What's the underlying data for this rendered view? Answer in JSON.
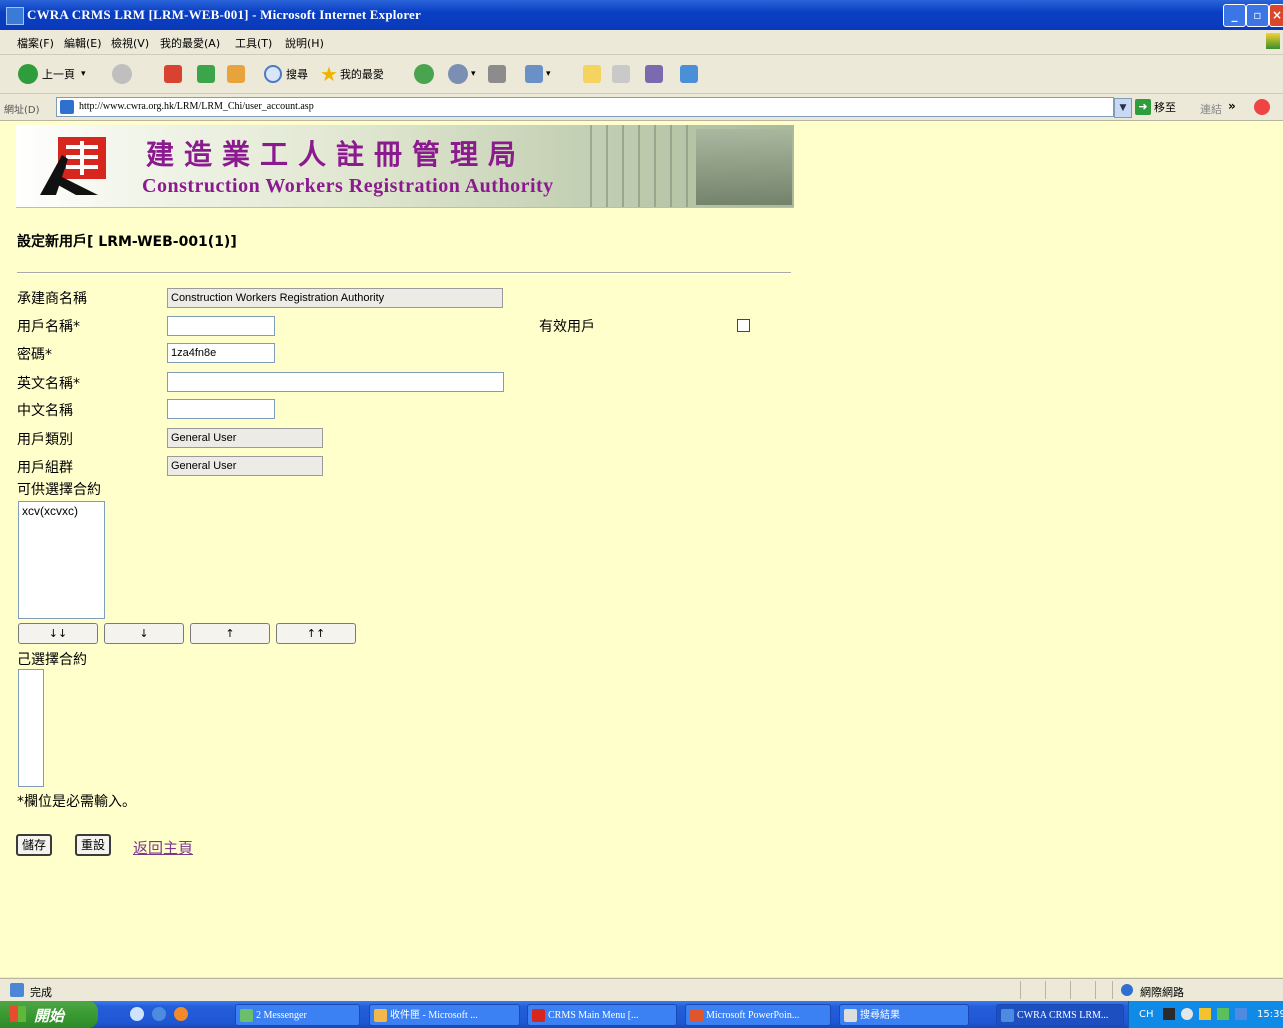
{
  "window": {
    "title": "CWRA CRMS LRM [LRM-WEB-001] - Microsoft Internet Explorer",
    "min": "_",
    "max": "▫",
    "close": "×"
  },
  "menu": {
    "items": [
      "檔案(F)",
      "編輯(E)",
      "檢視(V)",
      "我的最愛(A)",
      "工具(T)",
      "說明(H)"
    ]
  },
  "toolbar": {
    "back": "上一頁",
    "search": "搜尋",
    "favorites": "我的最愛"
  },
  "address": {
    "label": "網址(D)",
    "url": "http://www.cwra.org.hk/LRM/LRM_Chi/user_account.asp",
    "go": "移至",
    "links": "連結",
    "more": "»"
  },
  "banner": {
    "zh": "建造業工人註冊管理局",
    "en": "Construction Workers Registration Authority"
  },
  "page": {
    "title": "設定新用戶[ LRM-WEB-001(1)]",
    "form": {
      "contractor_label": "承建商名稱",
      "contractor_value": "Construction Workers Registration Authority",
      "username_label": "用戶名稱*",
      "username_value": "",
      "active_label": "有效用戶",
      "active_checked": false,
      "password_label": "密碼*",
      "password_value": "1za4fn8e",
      "english_name_label": "英文名稱*",
      "english_name_value": "",
      "chinese_name_label": "中文名稱",
      "chinese_name_value": "",
      "user_type_label": "用戶類別",
      "user_type_value": "General User",
      "user_group_label": "用戶組群",
      "user_group_value": "General User",
      "available_label": "可供選擇合約",
      "available_contracts": [
        "xcv(xcvxc)"
      ],
      "selected_label": "己選擇合約",
      "selected_contracts": [],
      "move_buttons": [
        "↓↓",
        "↓",
        "↑",
        "↑↑"
      ]
    },
    "required_note": "*欄位是必需輸入。",
    "save": "儲存",
    "reset": "重設",
    "back_home": "返回主頁"
  },
  "status": {
    "text": "完成",
    "zone": "網際網路"
  },
  "taskbar": {
    "start": "開始",
    "tasks": [
      "2 Messenger",
      "收件匣 - Microsoft ...",
      "CRMS Main Menu [...",
      "Microsoft PowerPoin...",
      "搜尋結果",
      "CWRA CRMS LRM..."
    ],
    "lang": "CH",
    "time": "15:39"
  },
  "colors": {
    "page_bg": "#ffffcc",
    "banner_text": "#8b1a8f",
    "link": "#7a3a8c",
    "titlebar": "#0a3fc4"
  }
}
